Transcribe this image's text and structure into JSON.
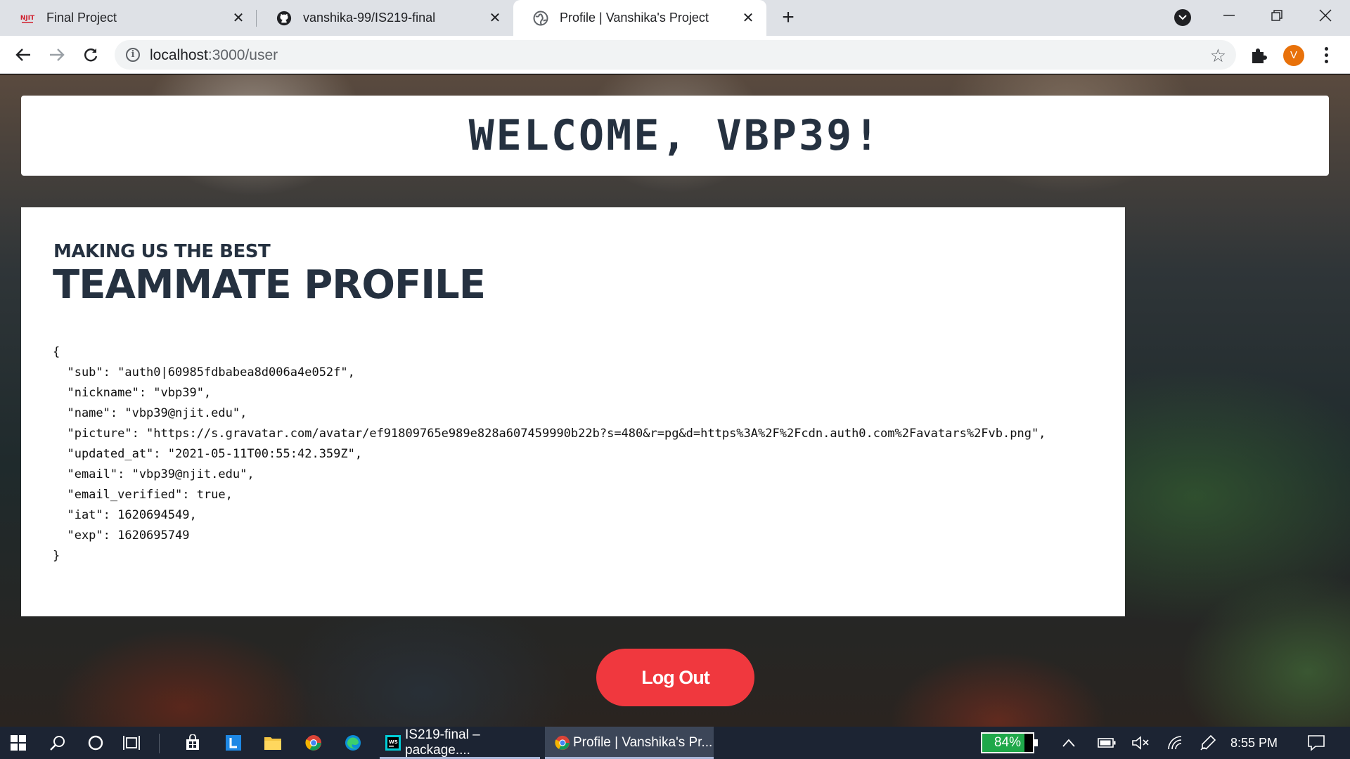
{
  "browser": {
    "tabs": [
      {
        "title": "Final Project",
        "favicon": "njit-logo-icon",
        "active": false
      },
      {
        "title": "vanshika-99/IS219-final",
        "favicon": "github-icon",
        "active": false
      },
      {
        "title": "Profile | Vanshika's Project",
        "favicon": "globe-icon",
        "active": true
      }
    ],
    "url_host": "localhost",
    "url_path": ":3000/user",
    "profile_initial": "V"
  },
  "page": {
    "welcome_text": "WELCOME, VBP39!",
    "kicker": "MAKING US THE BEST",
    "heading": "TEAMMATE PROFILE",
    "profile_json": "{\n  \"sub\": \"auth0|60985fdbabea8d006a4e052f\",\n  \"nickname\": \"vbp39\",\n  \"name\": \"vbp39@njit.edu\",\n  \"picture\": \"https://s.gravatar.com/avatar/ef91809765e989e828a607459990b22b?s=480&r=pg&d=https%3A%2F%2Fcdn.auth0.com%2Favatars%2Fvb.png\",\n  \"updated_at\": \"2021-05-11T00:55:42.359Z\",\n  \"email\": \"vbp39@njit.edu\",\n  \"email_verified\": true,\n  \"iat\": 1620694549,\n  \"exp\": 1620695749\n}",
    "logout_label": "Log Out",
    "colors": {
      "accent": "#f0383e",
      "heading": "#253140"
    }
  },
  "taskbar": {
    "apps": [
      {
        "title": "IS219-final – package....",
        "icon": "webstorm-icon"
      },
      {
        "title": "Profile | Vanshika's Pr...",
        "icon": "chrome-icon"
      }
    ],
    "battery_percent": 84,
    "battery_label": "84%",
    "time": "8:55 PM"
  }
}
